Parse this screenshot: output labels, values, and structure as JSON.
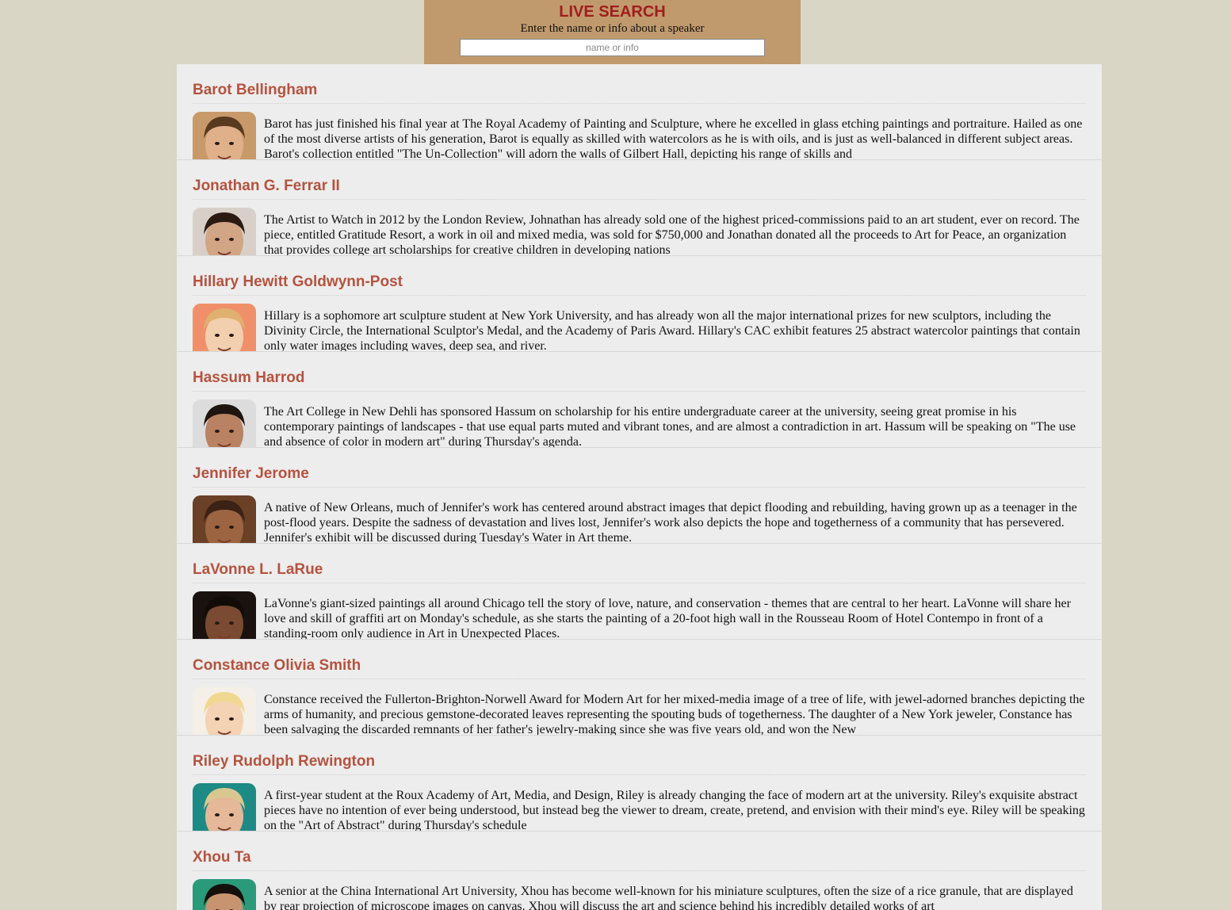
{
  "search": {
    "title": "LIVE SEARCH",
    "subtitle": "Enter the name or info about a speaker",
    "placeholder": "name or info"
  },
  "speakers": [
    {
      "name": "Barot Bellingham",
      "bio": "Barot has just finished his final year at The Royal Academy of Painting and Sculpture, where he excelled in glass etching paintings and portraiture. Hailed as one of the most diverse artists of his generation, Barot is equally as skilled with watercolors as he is with oils, and is just as well-balanced in different subject areas. Barot's collection entitled \"The Un-Collection\" will adorn the walls of Gilbert Hall, depicting his range of skills and",
      "photo": {
        "bg": "#c89a6a",
        "hair": "#5a3a1e",
        "skin": "#e0b08a"
      }
    },
    {
      "name": "Jonathan G. Ferrar II",
      "bio": "The Artist to Watch in 2012 by the London Review, Johnathan has already sold one of the highest priced-commissions paid to an art student, ever on record. The piece, entitled Gratitude Resort, a work in oil and mixed media, was sold for $750,000 and Jonathan donated all the proceeds to Art for Peace, an organization that provides college art scholarships for creative children in developing nations",
      "photo": {
        "bg": "#d8d0c8",
        "hair": "#2a1a12",
        "skin": "#d2a585"
      }
    },
    {
      "name": "Hillary Hewitt Goldwynn-Post",
      "bio": "Hillary is a sophomore art sculpture student at New York University, and has already won all the major international prizes for new sculptors, including the Divinity Circle, the International Sculptor's Medal, and the Academy of Paris Award. Hillary's CAC exhibit features 25 abstract watercolor paintings that contain only water images including waves, deep sea, and river.",
      "photo": {
        "bg": "#f0906a",
        "hair": "#e0b070",
        "skin": "#f2cfae"
      }
    },
    {
      "name": "Hassum Harrod",
      "bio": "The Art College in New Dehli has sponsored Hassum on scholarship for his entire undergraduate career at the university, seeing great promise in his contemporary paintings of landscapes - that use equal parts muted and vibrant tones, and are almost a contradiction in art. Hassum will be speaking on \"The use and absence of color in modern art\" during Thursday's agenda.",
      "photo": {
        "bg": "#dcdcdc",
        "hair": "#1e1410",
        "skin": "#b98262"
      }
    },
    {
      "name": "Jennifer Jerome",
      "bio": "A native of New Orleans, much of Jennifer's work has centered around abstract images that depict flooding and rebuilding, having grown up as a teenager in the post-flood years. Despite the sadness of devastation and lives lost, Jennifer's work also depicts the hope and togetherness of a community that has persevered. Jennifer's exhibit will be discussed during Tuesday's Water in Art theme.",
      "photo": {
        "bg": "#6a4026",
        "hair": "#3b2214",
        "skin": "#9c6440"
      }
    },
    {
      "name": "LaVonne L. LaRue",
      "bio": "LaVonne's giant-sized paintings all around Chicago tell the story of love, nature, and conservation - themes that are central to her heart. LaVonne will share her love and skill of graffiti art on Monday's schedule, as she starts the painting of a 20-foot high wall in the Rousseau Room of Hotel Contempo in front of a standing-room only audience in Art in Unexpected Places.",
      "photo": {
        "bg": "#1a120e",
        "hair": "#120c08",
        "skin": "#7a4a32"
      }
    },
    {
      "name": "Constance Olivia Smith",
      "bio": "Constance received the Fullerton-Brighton-Norwell Award for Modern Art for her mixed-media image of a tree of life, with jewel-adorned branches depicting the arms of humanity, and precious gemstone-decorated leaves representing the spouting buds of togetherness. The daughter of a New York jeweler, Constance has been salvaging the discarded remnants of her father's jewelry-making since she was five years old, and won the New",
      "photo": {
        "bg": "#f4f0e8",
        "hair": "#f0d890",
        "skin": "#f4d2b4"
      }
    },
    {
      "name": "Riley Rudolph Rewington",
      "bio": "A first-year student at the Roux Academy of Art, Media, and Design, Riley is already changing the face of modern art at the university. Riley's exquisite abstract pieces have no intention of ever being understood, but instead beg the viewer to dream, create, pretend, and envision with their mind's eye. Riley will be speaking on the \"Art of Abstract\" during Thursday's schedule",
      "photo": {
        "bg": "#1e8a86",
        "hair": "#d8c890",
        "skin": "#e4b898"
      }
    },
    {
      "name": "Xhou Ta",
      "bio": "A senior at the China International Art University, Xhou has become well-known for his miniature sculptures, often the size of a rice granule, that are displayed by rear projection of microscope images on canvas. Xhou will discuss the art and science behind his incredibly detailed works of art",
      "photo": {
        "bg": "#2a9a7a",
        "hair": "#16100c",
        "skin": "#c89470"
      }
    }
  ]
}
